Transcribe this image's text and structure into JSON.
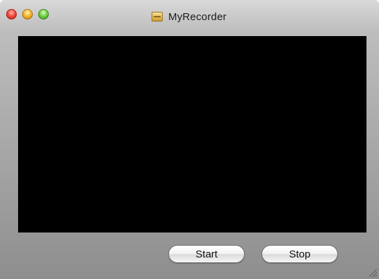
{
  "window": {
    "title": "MyRecorder",
    "title_icon": "recorder-app-icon",
    "traffic_lights": {
      "close_color": "#f0463b",
      "minimize_color": "#f2b52b",
      "zoom_color": "#6fcd45"
    }
  },
  "preview": {
    "background": "#000000"
  },
  "controls": {
    "start_label": "Start",
    "stop_label": "Stop"
  }
}
